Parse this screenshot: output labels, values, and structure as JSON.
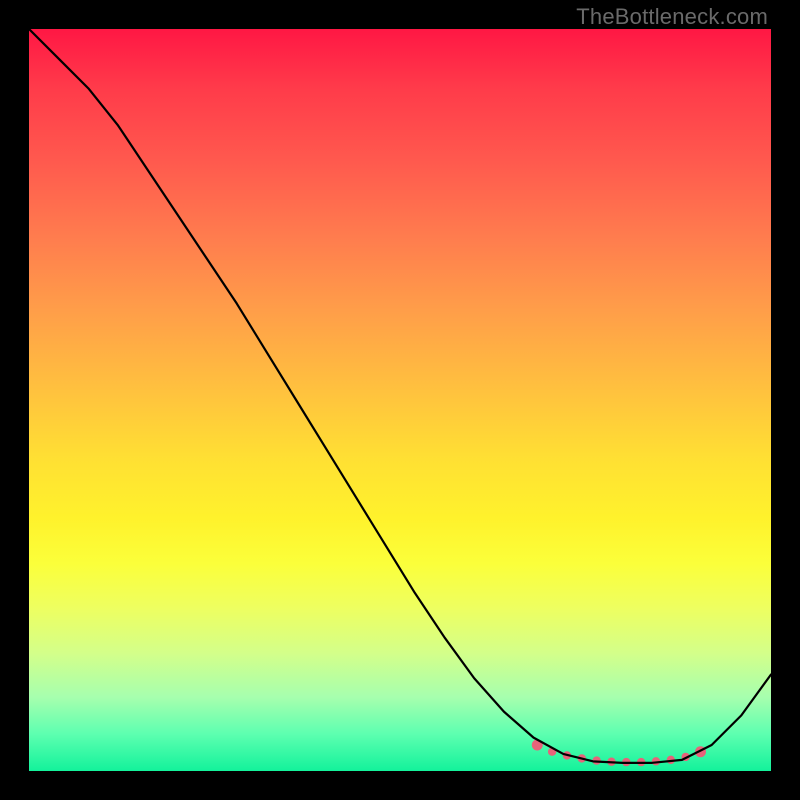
{
  "watermark": "TheBottleneck.com",
  "chart_data": {
    "type": "line",
    "title": "",
    "xlabel": "",
    "ylabel": "",
    "xlim": [
      0,
      100
    ],
    "ylim": [
      0,
      100
    ],
    "description": "Bottleneck curve: starts near 100 at x≈0, descends steeply to a flat minimum near 0 around x≈72–88, then rises toward x=100.",
    "series": [
      {
        "name": "bottleneck-curve",
        "color": "#000000",
        "x": [
          0,
          4,
          8,
          12,
          16,
          20,
          24,
          28,
          32,
          36,
          40,
          44,
          48,
          52,
          56,
          60,
          64,
          68,
          72,
          76,
          80,
          84,
          88,
          92,
          96,
          100
        ],
        "y": [
          100,
          96,
          92,
          87,
          81,
          75,
          69,
          63,
          56.5,
          50,
          43.5,
          37,
          30.5,
          24,
          18,
          12.5,
          8,
          4.5,
          2.3,
          1.3,
          1.1,
          1.1,
          1.5,
          3.5,
          7.5,
          13
        ]
      }
    ],
    "markers": {
      "name": "optimal-range-dots",
      "color": "#e6637a",
      "x": [
        68.5,
        70.5,
        72.5,
        74.5,
        76.5,
        78.5,
        80.5,
        82.5,
        84.5,
        86.5,
        88.5,
        90.5
      ],
      "y": [
        3.5,
        2.6,
        2.1,
        1.7,
        1.4,
        1.25,
        1.2,
        1.2,
        1.3,
        1.5,
        1.9,
        2.6
      ]
    }
  }
}
